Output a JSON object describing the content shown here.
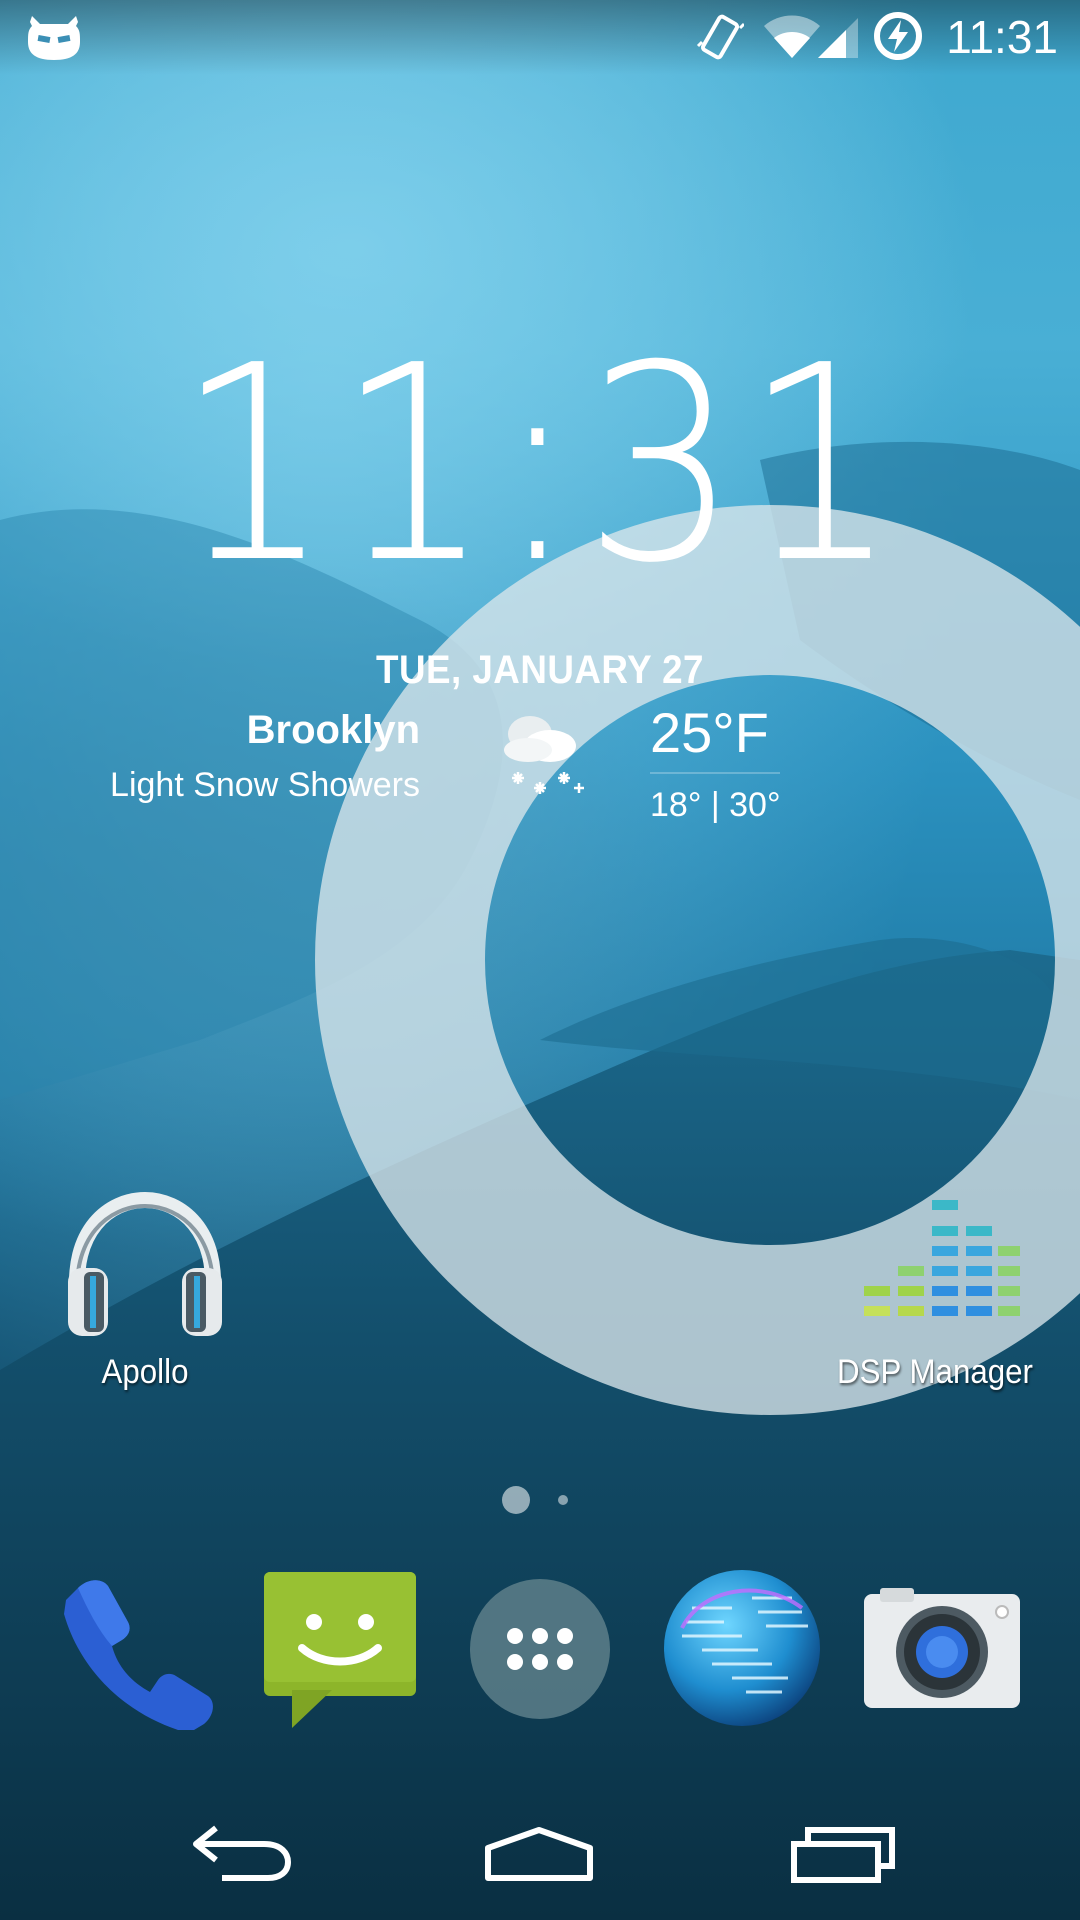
{
  "status_bar": {
    "time": "11:31",
    "icons": [
      "cyanogenmod-icon",
      "vibrate-icon",
      "wifi-icon",
      "signal-icon",
      "battery-charging-icon"
    ]
  },
  "clock_widget": {
    "time": "11:31",
    "date": "TUE, JANUARY 27"
  },
  "weather": {
    "city": "Brooklyn",
    "condition": "Light Snow Showers",
    "temperature": "25°F",
    "range": "18° | 30°",
    "icon": "snow-cloud-icon"
  },
  "home_apps": [
    {
      "label": "Apollo",
      "icon": "headphones-icon"
    },
    {
      "label": "DSP Manager",
      "icon": "equalizer-icon"
    }
  ],
  "page_indicator": {
    "pages": 2,
    "current": 1
  },
  "dock": [
    {
      "name": "phone",
      "icon": "phone-icon"
    },
    {
      "name": "messaging",
      "icon": "message-icon"
    },
    {
      "name": "app-drawer",
      "icon": "apps-grid-icon"
    },
    {
      "name": "browser",
      "icon": "globe-icon"
    },
    {
      "name": "camera",
      "icon": "camera-icon"
    }
  ],
  "nav_bar": [
    "back-icon",
    "home-icon",
    "recents-icon"
  ],
  "colors": {
    "ring": "#d9e6ea",
    "accent_blue": "#2f6fdc",
    "message_green": "#8bb22a"
  }
}
